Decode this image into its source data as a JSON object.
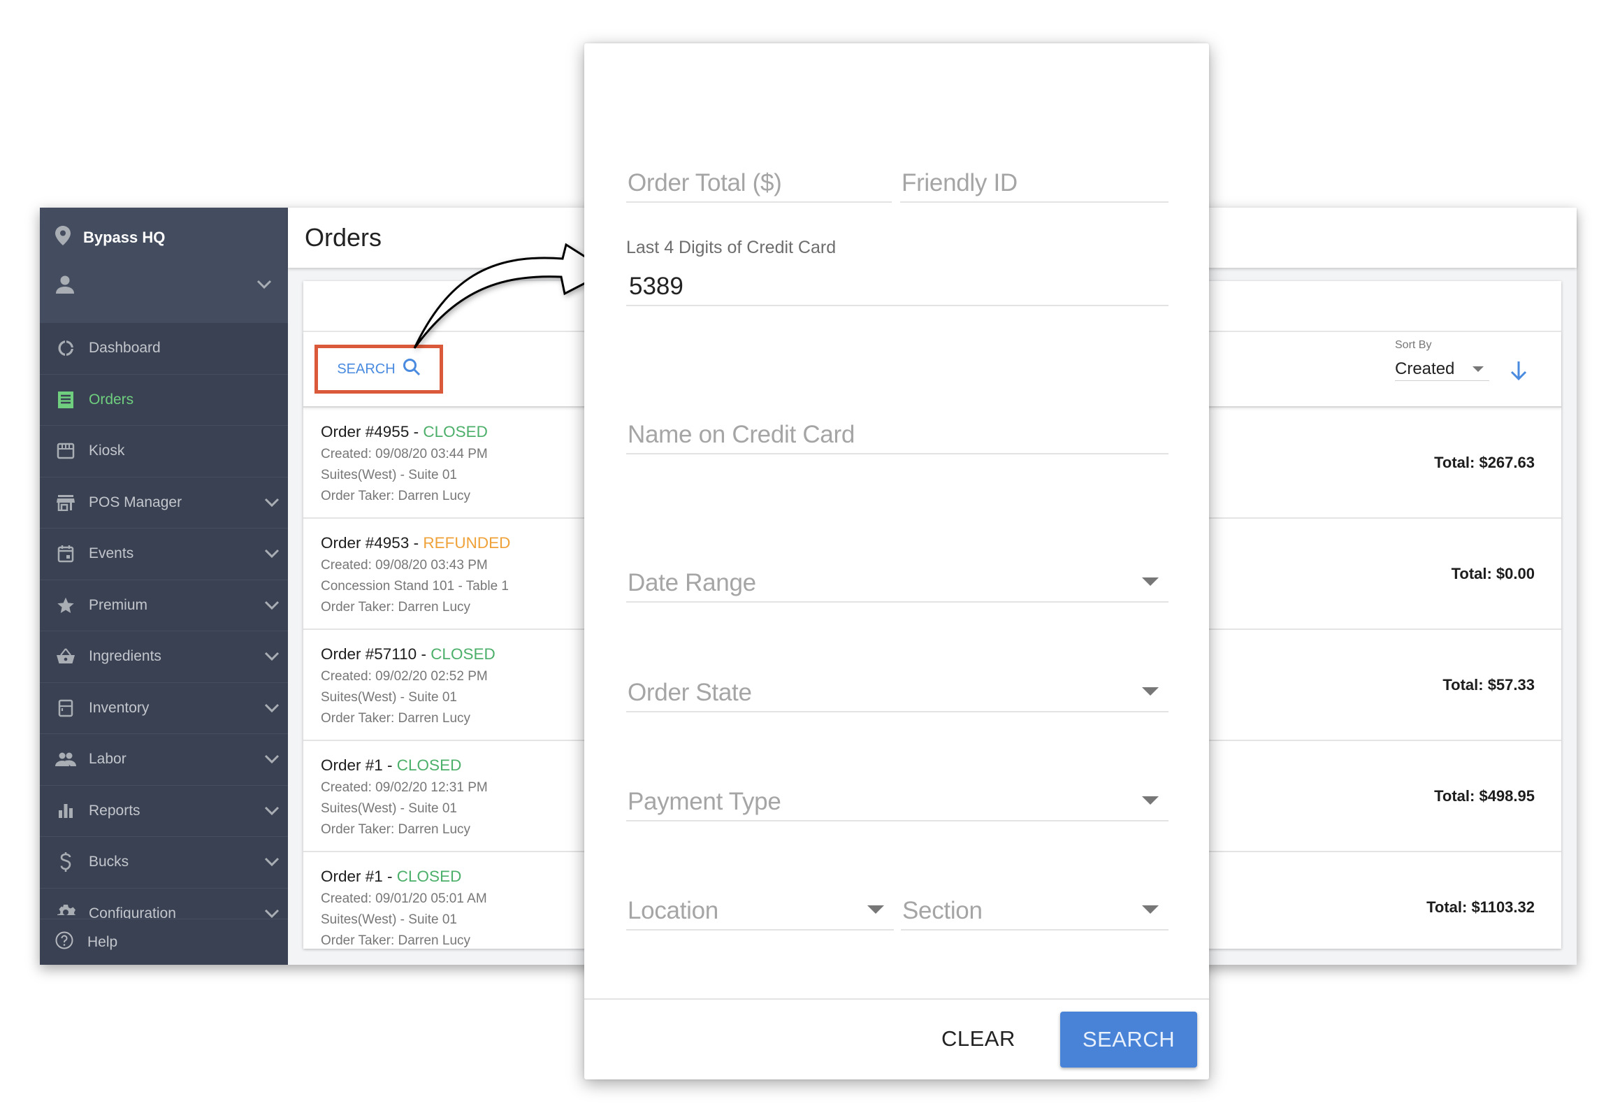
{
  "sidebar": {
    "brand": "Bypass HQ",
    "items": [
      {
        "label": "Dashboard",
        "icon": "dashboard-icon",
        "expandable": false,
        "active": false
      },
      {
        "label": "Orders",
        "icon": "receipt-icon",
        "expandable": false,
        "active": true
      },
      {
        "label": "Kiosk",
        "icon": "kiosk-icon",
        "expandable": false,
        "active": false
      },
      {
        "label": "POS Manager",
        "icon": "store-icon",
        "expandable": true,
        "active": false
      },
      {
        "label": "Events",
        "icon": "calendar-icon",
        "expandable": true,
        "active": false
      },
      {
        "label": "Premium",
        "icon": "star-icon",
        "expandable": true,
        "active": false
      },
      {
        "label": "Ingredients",
        "icon": "basket-icon",
        "expandable": true,
        "active": false
      },
      {
        "label": "Inventory",
        "icon": "fridge-icon",
        "expandable": true,
        "active": false
      },
      {
        "label": "Labor",
        "icon": "people-icon",
        "expandable": true,
        "active": false
      },
      {
        "label": "Reports",
        "icon": "bar-chart-icon",
        "expandable": true,
        "active": false
      },
      {
        "label": "Bucks",
        "icon": "dollar-icon",
        "expandable": true,
        "active": false
      },
      {
        "label": "Configuration",
        "icon": "gear-icon",
        "expandable": true,
        "active": false
      }
    ],
    "help": "Help"
  },
  "page": {
    "title": "Orders",
    "search_label": "SEARCH",
    "sort_by_caption": "Sort By",
    "sort_by_value": "Created"
  },
  "orders": [
    {
      "title": "Order #4955",
      "status": "CLOSED",
      "status_color": "#4caf6a",
      "created": "Created: 09/08/20 03:44 PM",
      "location": "Suites(West) - Suite 01",
      "taker": "Order Taker: Darren Lucy",
      "total": "Total: $267.63"
    },
    {
      "title": "Order #4953",
      "status": "REFUNDED",
      "status_color": "#f0a23a",
      "created": "Created: 09/08/20 03:43 PM",
      "location": "Concession Stand 101 - Table 1",
      "taker": "Order Taker: Darren Lucy",
      "total": "Total: $0.00"
    },
    {
      "title": "Order #57110",
      "status": "CLOSED",
      "status_color": "#4caf6a",
      "created": "Created: 09/02/20 02:52 PM",
      "location": "Suites(West) - Suite 01",
      "taker": "Order Taker: Darren Lucy",
      "total": "Total: $57.33"
    },
    {
      "title": "Order #1",
      "status": "CLOSED",
      "status_color": "#4caf6a",
      "created": "Created: 09/02/20 12:31 PM",
      "location": "Suites(West) - Suite 01",
      "taker": "Order Taker: Darren Lucy",
      "total": "Total: $498.95"
    },
    {
      "title": "Order #1",
      "status": "CLOSED",
      "status_color": "#4caf6a",
      "created": "Created: 09/01/20 05:01 AM",
      "location": "Suites(West) - Suite 01",
      "taker": "Order Taker: Darren Lucy",
      "total": "Total: $1103.32"
    }
  ],
  "search_modal": {
    "order_total_placeholder": "Order Total ($)",
    "friendly_id_placeholder": "Friendly ID",
    "cc_last4_label": "Last 4 Digits of Credit Card",
    "cc_last4_value": "5389",
    "cc_name_placeholder": "Name on Credit Card",
    "date_range_placeholder": "Date Range",
    "order_state_placeholder": "Order State",
    "payment_type_placeholder": "Payment Type",
    "location_placeholder": "Location",
    "section_placeholder": "Section",
    "clear_label": "CLEAR",
    "search_label": "SEARCH"
  },
  "colors": {
    "accent_blue": "#4883d8",
    "active_green": "#6fcf7f",
    "highlight_box": "#d9593a",
    "sidebar_bg": "#394152"
  }
}
